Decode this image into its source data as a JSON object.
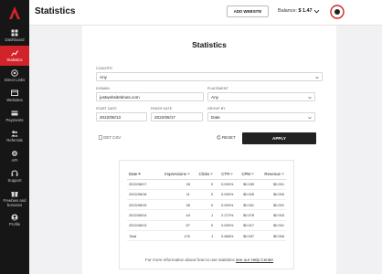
{
  "colors": {
    "accent": "#d2232a",
    "sidebar": "#161616",
    "apply": "#222222"
  },
  "sidebar": {
    "items": [
      {
        "label": "Dashboard",
        "icon": "dashboard-icon"
      },
      {
        "label": "Statistics",
        "icon": "chart-line-icon",
        "active": true
      },
      {
        "label": "Direct Links",
        "icon": "direct-link-icon"
      },
      {
        "label": "Websites",
        "icon": "globe-icon"
      },
      {
        "label": "Payments",
        "icon": "payments-icon"
      },
      {
        "label": "Referrals",
        "icon": "referrals-icon"
      },
      {
        "label": "API",
        "icon": "api-icon"
      },
      {
        "label": "Support",
        "icon": "support-icon"
      },
      {
        "label": "Freebies and",
        "label2": "bonuses",
        "icon": "gift-icon"
      },
      {
        "label": "Profile",
        "icon": "profile-icon"
      }
    ]
  },
  "header": {
    "title": "Statistics",
    "add_website": "ADD WEBSITE",
    "balance_label": "Balance:",
    "balance_value": "$ 1.47"
  },
  "main": {
    "title": "Statistics",
    "filters": {
      "country": {
        "label": "COUNTRY",
        "value": "Any"
      },
      "domain": {
        "label": "DOMAIN",
        "value": "justwebsitetimes.com"
      },
      "placement": {
        "label": "PLACEMENT",
        "value": "Any"
      },
      "start_date": {
        "label": "START DATE",
        "value": "2022/08/13"
      },
      "finish_date": {
        "label": "FINISH DATE",
        "value": "2022/08/17"
      },
      "group_by": {
        "label": "GROUP BY",
        "value": "Date"
      }
    },
    "get_csv": "GET CSV",
    "reset": "RESET",
    "apply": "APPLY",
    "table": {
      "columns": [
        "Date",
        "Impressions",
        "Clicks",
        "CTR",
        "CPM",
        "Revenue"
      ],
      "rows": [
        [
          "2022/08/17",
          "28",
          "0",
          "0.000%",
          "$0.039",
          "$0.001"
        ],
        [
          "2022/08/16",
          "11",
          "0",
          "0.000%",
          "$0.025",
          "$0.000"
        ],
        [
          "2022/08/15",
          "36",
          "0",
          "0.000%",
          "$0.031",
          "$0.001"
        ],
        [
          "2022/08/14",
          "44",
          "1",
          "2.272%",
          "$0.078",
          "$0.003"
        ],
        [
          "2022/08/13",
          "57",
          "0",
          "0.000%",
          "$0.017",
          "$0.001"
        ],
        [
          "Total",
          "176",
          "1",
          "0.568%",
          "$0.037",
          "$0.006"
        ]
      ]
    },
    "footnote_prefix": "For more information about how to use statistics ",
    "footnote_link": "see our Help Center"
  }
}
